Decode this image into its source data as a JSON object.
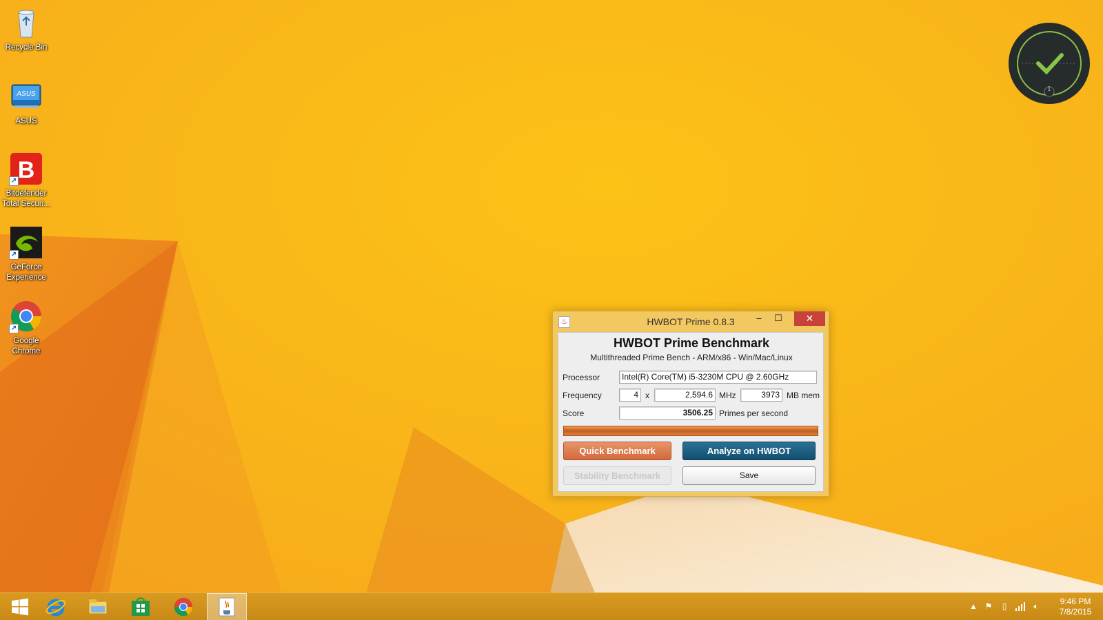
{
  "desktop": {
    "icons": [
      {
        "label": "Recycle Bin",
        "icon": "recycle-bin-icon"
      },
      {
        "label": "ASUS",
        "icon": "asus-icon"
      },
      {
        "label": "Bitdefender\nTotal Securi...",
        "icon": "bitdefender-icon"
      },
      {
        "label": "GeForce\nExperience",
        "icon": "geforce-icon"
      },
      {
        "label": "Google\nChrome",
        "icon": "chrome-icon"
      }
    ]
  },
  "gadget": {
    "badge": "1",
    "icon": "checkmark-icon",
    "accent": "#8bc34a"
  },
  "window": {
    "title": "HWBOT Prime 0.8.3",
    "controls": {
      "minimize": "–",
      "maximize": "☐",
      "close": "✕"
    },
    "heading": "HWBOT Prime Benchmark",
    "subheading": "Multithreaded Prime Bench - ARM/x86 - Win/Mac/Linux",
    "processor": {
      "label": "Processor",
      "value": "Intel(R) Core(TM) i5-3230M CPU @ 2.60GHz"
    },
    "frequency": {
      "label": "Frequency",
      "cores": "4",
      "times": "x",
      "mhz_value": "2,594.6",
      "mhz_unit": "MHz",
      "mem_value": "3973",
      "mem_unit": "MB mem"
    },
    "score": {
      "label": "Score",
      "value": "3506.25",
      "unit": "Primes per second"
    },
    "progress": 1.0,
    "buttons": {
      "quick": "Quick Benchmark",
      "analyze": "Analyze on HWBOT",
      "stability": "Stability Benchmark",
      "save": "Save"
    },
    "colors": {
      "title_bg": "#f3c860",
      "quick_bg": "#d8733f",
      "analyze_bg": "#1a5b7d",
      "close_bg": "#c8413a"
    }
  },
  "taskbar": {
    "items": [
      {
        "icon": "windows-start-icon",
        "active": false
      },
      {
        "icon": "internet-explorer-icon",
        "active": false
      },
      {
        "icon": "file-explorer-icon",
        "active": false
      },
      {
        "icon": "windows-store-icon",
        "active": false
      },
      {
        "icon": "chrome-icon",
        "active": false
      },
      {
        "icon": "java-icon",
        "active": true
      }
    ],
    "tray": [
      "show-hidden-icons-icon",
      "action-center-flag-icon",
      "power-icon",
      "network-signal-icon",
      "volume-icon"
    ],
    "clock": {
      "time": "9:46 PM",
      "date": "7/8/2015"
    }
  }
}
